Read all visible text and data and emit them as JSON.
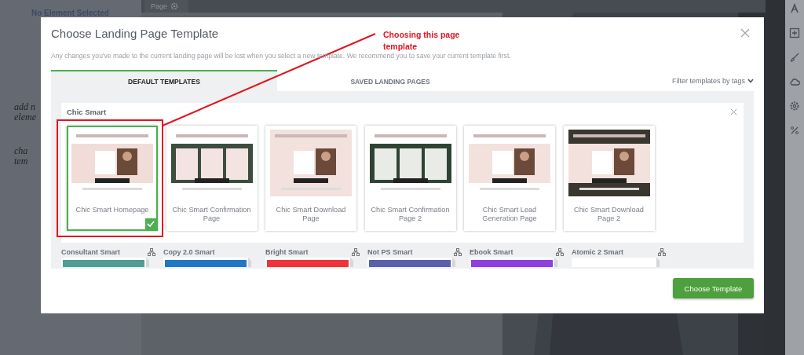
{
  "background": {
    "sidebar_title": "No Element Selected",
    "sidebar_notes": [
      "add n",
      "eleme",
      "cha",
      "tem"
    ],
    "top_bar_label": "Page"
  },
  "modal": {
    "title": "Choose Landing Page Template",
    "notice": "Any changes you've made to the current landing page will be lost when you select a new template. We recommend you to save your current template first.",
    "tabs": [
      {
        "label": "DEFAULT TEMPLATES",
        "selected": true
      },
      {
        "label": "SAVED LANDING PAGES",
        "selected": false
      }
    ],
    "filter": "Filter templates by tags",
    "open_group": {
      "title": "Chic Smart",
      "templates": [
        {
          "name": "Chic Smart Homepage",
          "selected": true,
          "annotated": true
        },
        {
          "name": "Chic Smart Confirmation Page",
          "selected": false,
          "annotated": false
        },
        {
          "name": "Chic Smart Download Page",
          "selected": false,
          "annotated": false
        },
        {
          "name": "Chic Smart Confirmation Page 2",
          "selected": false,
          "annotated": false
        },
        {
          "name": "Chic Smart Lead Generation Page",
          "selected": false,
          "annotated": false
        },
        {
          "name": "Chic Smart Download Page 2",
          "selected": false,
          "annotated": false
        }
      ]
    },
    "groups": [
      {
        "title": "Consultant Smart",
        "sitemap": true
      },
      {
        "title": "Copy 2.0 Smart",
        "sitemap": false
      },
      {
        "title": "Bright Smart",
        "sitemap": true
      },
      {
        "title": "Not PS Smart",
        "sitemap": true
      },
      {
        "title": "Ebook Smart",
        "sitemap": true
      },
      {
        "title": "Atomic 2 Smart",
        "sitemap": true
      }
    ],
    "button": "Choose Template"
  },
  "annotation": {
    "text": "Choosing this page template"
  }
}
